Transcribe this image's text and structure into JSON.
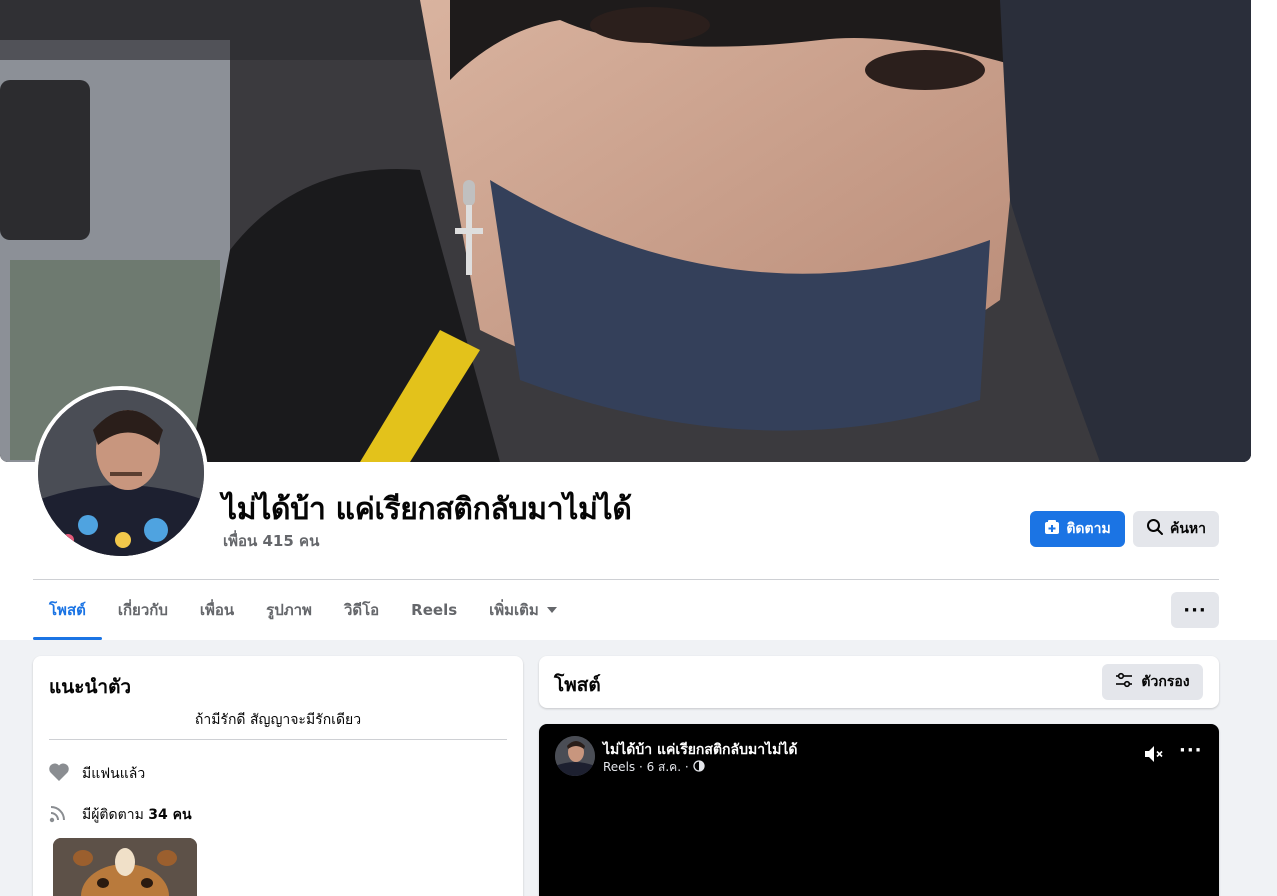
{
  "profile": {
    "name": "ไม่ได้บ้า แค่เรียกสติกลับมาไม่ได้",
    "friends": "เพื่อน 415 คน"
  },
  "actions": {
    "follow_label": "ติดตาม",
    "search_label": "ค้นหา",
    "more_label": "···"
  },
  "tabs": [
    {
      "label": "โพสต์",
      "active": true
    },
    {
      "label": "เกี่ยวกับ"
    },
    {
      "label": "เพื่อน"
    },
    {
      "label": "รูปภาพ"
    },
    {
      "label": "วิดีโอ"
    },
    {
      "label": "Reels"
    },
    {
      "label": "เพิ่มเติม"
    }
  ],
  "intro": {
    "title": "แนะนำตัว",
    "bio": "ถ้ามีรักดี สัญญาจะมีรักเดียว",
    "relationship": "มีแฟนแล้ว",
    "followers_prefix": "มีผู้ติดตาม ",
    "followers_count": "34 คน"
  },
  "posts": {
    "title": "โพสต์",
    "filter_label": "ตัวกรอง"
  },
  "post": {
    "author": "ไม่ได้บ้า แค่เรียกสติกลับมาไม่ได้",
    "meta": "Reels · 6 ส.ค. ·",
    "more_label": "···"
  },
  "colors": {
    "accent": "#1b74e4",
    "page_bg": "#f0f2f5",
    "secondary_text": "#65676b"
  },
  "icons": {
    "follow": "follow-plus-icon",
    "search": "magnifier-icon",
    "heart": "heart-icon",
    "followers": "rss-icon",
    "filter": "sliders-icon",
    "mute": "speaker-muted-icon",
    "privacy": "globe-icon"
  }
}
